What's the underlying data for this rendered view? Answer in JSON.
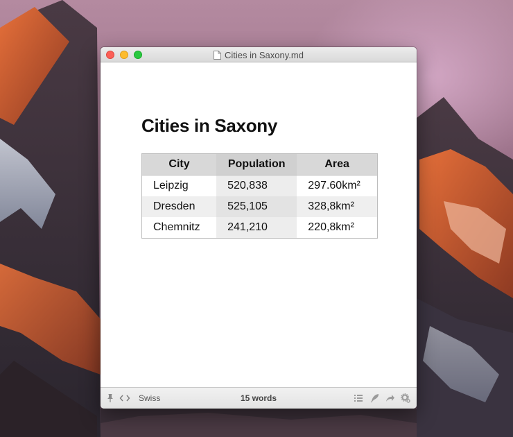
{
  "window": {
    "title": "Cities in Saxony.md"
  },
  "document": {
    "heading": "Cities in Saxony",
    "table": {
      "headers": [
        "City",
        "Population",
        "Area"
      ],
      "rows": [
        [
          "Leipzig",
          "520,838",
          "297.60km²"
        ],
        [
          "Dresden",
          "525,105",
          "328,8km²"
        ],
        [
          "Chemnitz",
          "241,210",
          "220,8km²"
        ]
      ]
    }
  },
  "statusbar": {
    "theme": "Swiss",
    "word_count": "15 words",
    "icons": [
      "pin-icon",
      "code-icon",
      "list-icon",
      "feather-icon",
      "share-icon",
      "gear-icon"
    ]
  },
  "colors": {
    "close": "#fc5f57",
    "minimize": "#fdbc2e",
    "zoom": "#29c83f"
  }
}
